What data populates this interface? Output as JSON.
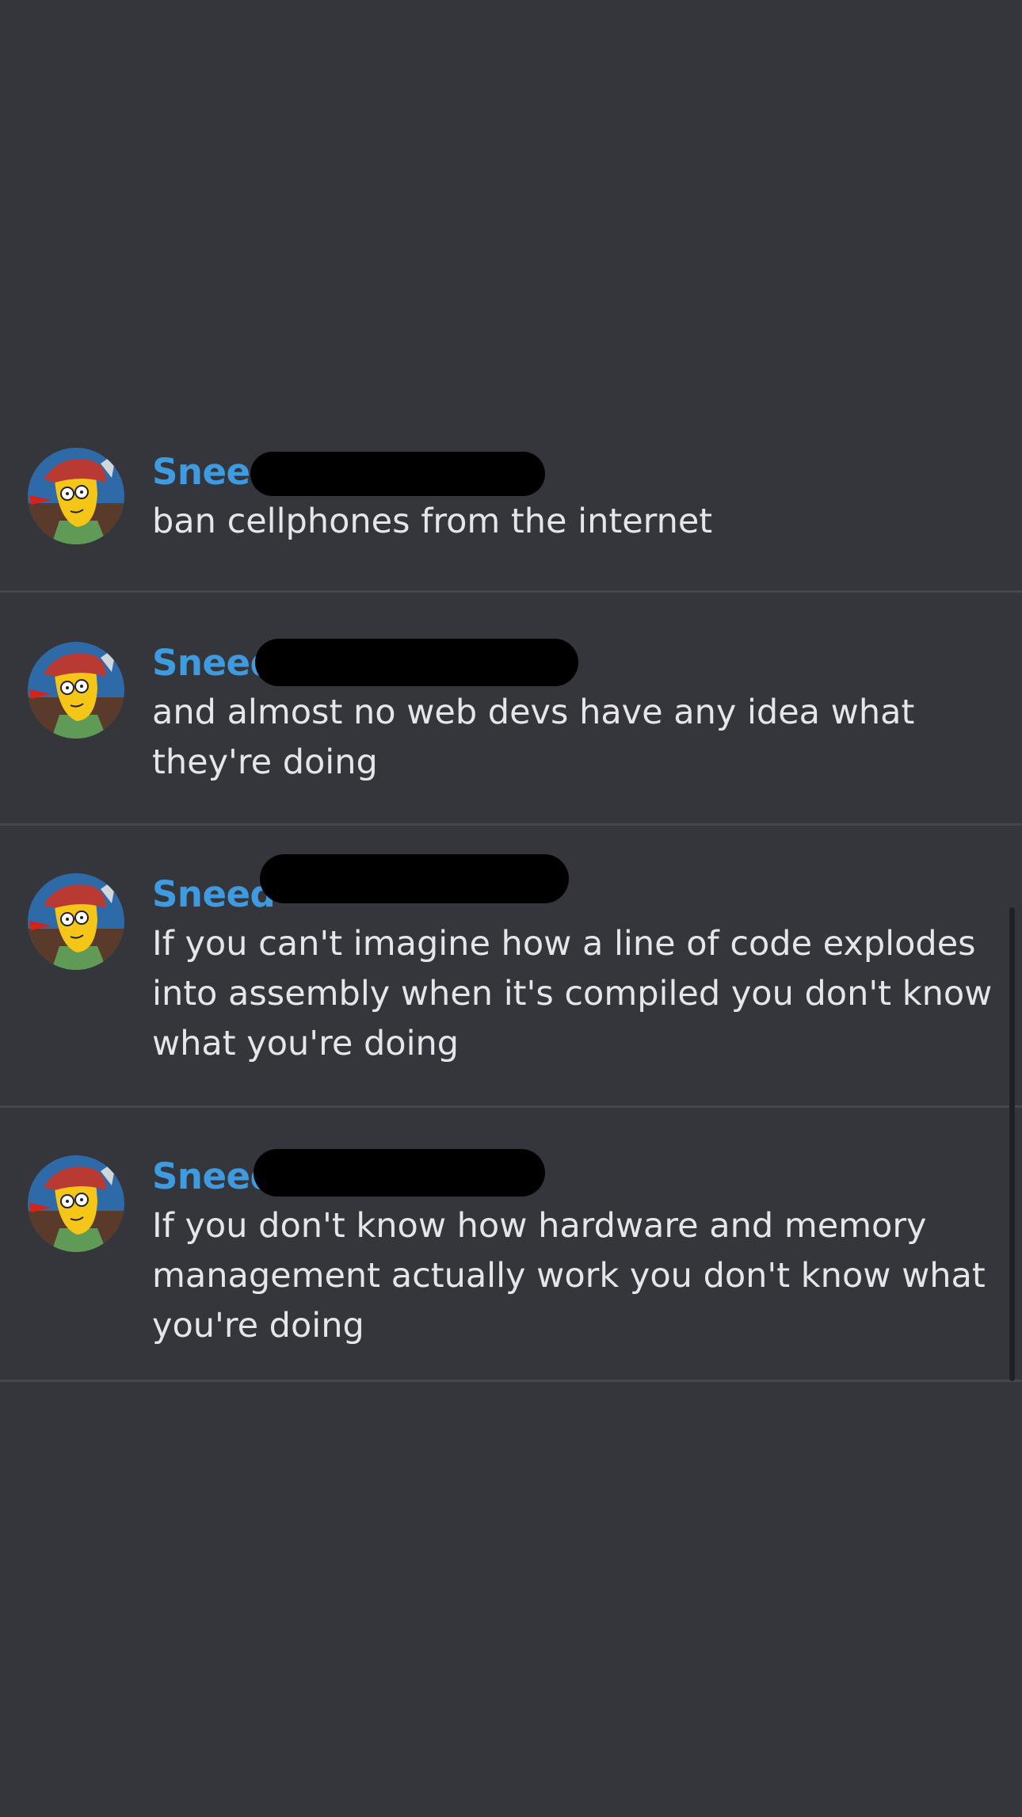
{
  "messages": [
    {
      "username": "Sneed",
      "text": "ban cellphones from the internet"
    },
    {
      "username": "Sneed",
      "text": "and almost no web devs have any idea what they're doing"
    },
    {
      "username": "Sneed",
      "text": "If you can't imagine how a line of code explodes into assembly when it's compiled you don't know what you're doing"
    },
    {
      "username": "Sneed",
      "text": "If you don't know how hardware and memory management actually work you don't know what you're doing"
    }
  ],
  "colors": {
    "background": "#34363c",
    "username": "#3f9be0",
    "message_text": "#e6e6e8",
    "divider": "#45474d"
  },
  "icons": {
    "avatar": "cartoon-avatar-icon"
  }
}
